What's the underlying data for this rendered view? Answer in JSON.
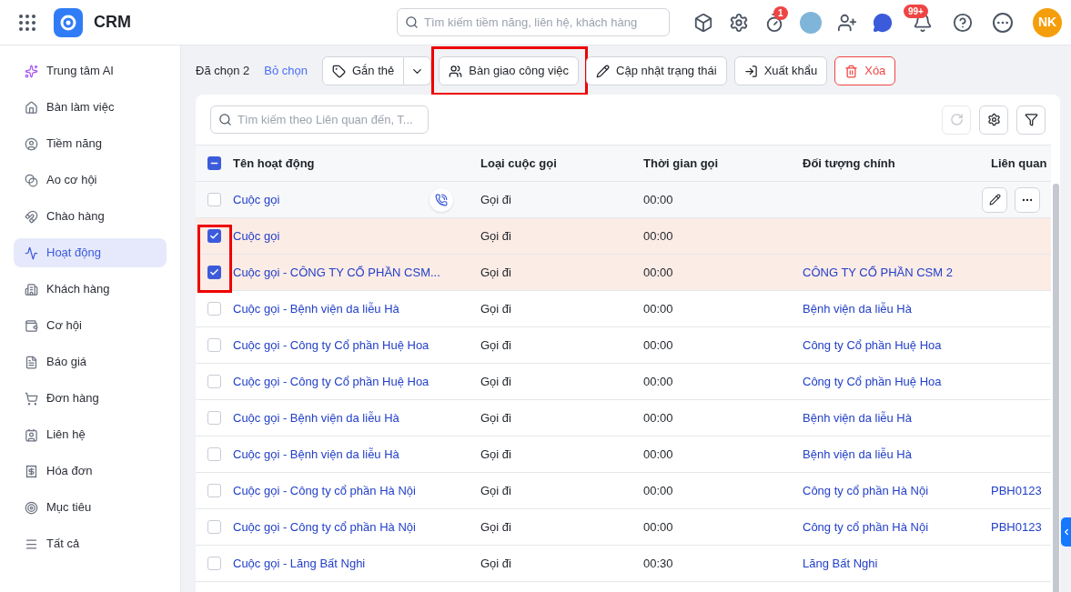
{
  "header": {
    "app_name": "CRM",
    "search": {
      "placeholder": "Tìm kiếm tiềm năng, liên hệ, khách hàng"
    },
    "timer_badge": "1",
    "notification_badge": "99+",
    "user_initials": "NK"
  },
  "sidebar": {
    "items": [
      {
        "label": "Trung tâm AI",
        "selected": false
      },
      {
        "label": "Bàn làm việc",
        "selected": false
      },
      {
        "label": "Tiềm năng",
        "selected": false
      },
      {
        "label": "Ao cơ hội",
        "selected": false
      },
      {
        "label": "Chào hàng",
        "selected": false
      },
      {
        "label": "Hoạt động",
        "selected": true
      },
      {
        "label": "Khách hàng",
        "selected": false
      },
      {
        "label": "Cơ hội",
        "selected": false
      },
      {
        "label": "Báo giá",
        "selected": false
      },
      {
        "label": "Đơn hàng",
        "selected": false
      },
      {
        "label": "Liên hệ",
        "selected": false
      },
      {
        "label": "Hóa đơn",
        "selected": false
      },
      {
        "label": "Mục tiêu",
        "selected": false
      },
      {
        "label": "Tất cả",
        "selected": false
      }
    ]
  },
  "bulk_bar": {
    "selected_count": "Đã chọn 2",
    "clear_link": "Bỏ chọn",
    "actions": [
      {
        "label": "Gắn thẻ",
        "kind": "split",
        "highlighted": false
      },
      {
        "label": "Bàn giao công việc",
        "kind": "normal",
        "highlighted": true
      },
      {
        "label": "Cập nhật trạng thái",
        "kind": "normal",
        "highlighted": false
      },
      {
        "label": "Xuất khẩu",
        "kind": "normal",
        "highlighted": false
      },
      {
        "label": "Xóa",
        "kind": "danger",
        "highlighted": false
      }
    ]
  },
  "table": {
    "search": {
      "placeholder": "Tìm kiếm theo Liên quan đến, T..."
    },
    "header_checkbox": {
      "indeterminate": true
    },
    "columns": [
      "Tên hoạt động",
      "Loại cuộc gọi",
      "Thời gian gọi",
      "Đối tượng chính",
      "Liên quan"
    ],
    "rows": [
      {
        "name": "Cuộc gọi",
        "type": "Gọi đi",
        "time": "00:00",
        "main_object": "",
        "related": "",
        "selected": false,
        "hovered": true
      },
      {
        "name": "Cuộc gọi",
        "type": "Gọi đi",
        "time": "00:00",
        "main_object": "",
        "related": "",
        "selected": true,
        "hovered": false
      },
      {
        "name": "Cuộc gọi - CÔNG TY CỔ PHẦN CSM...",
        "type": "Gọi đi",
        "time": "00:00",
        "main_object": "CÔNG TY CỔ PHẦN CSM 2",
        "related": "",
        "selected": true,
        "hovered": false
      },
      {
        "name": "Cuộc gọi - Bệnh viện da liễu Hà",
        "type": "Gọi đi",
        "time": "00:00",
        "main_object": "Bệnh viện da liễu Hà",
        "related": "",
        "selected": false,
        "hovered": false
      },
      {
        "name": "Cuộc gọi - Công ty Cổ phần Huệ Hoa",
        "type": "Gọi đi",
        "time": "00:00",
        "main_object": "Công ty Cổ phần Huệ Hoa",
        "related": "",
        "selected": false,
        "hovered": false
      },
      {
        "name": "Cuộc gọi - Công ty Cổ phần Huệ Hoa",
        "type": "Gọi đi",
        "time": "00:00",
        "main_object": "Công ty Cổ phần Huệ Hoa",
        "related": "",
        "selected": false,
        "hovered": false
      },
      {
        "name": "Cuộc gọi - Bệnh viện da liễu Hà",
        "type": "Gọi đi",
        "time": "00:00",
        "main_object": "Bệnh viện da liễu Hà",
        "related": "",
        "selected": false,
        "hovered": false
      },
      {
        "name": "Cuộc gọi - Bệnh viện da liễu Hà",
        "type": "Gọi đi",
        "time": "00:00",
        "main_object": "Bệnh viện da liễu Hà",
        "related": "",
        "selected": false,
        "hovered": false
      },
      {
        "name": "Cuộc gọi - Công ty cổ phần Hà Nội",
        "type": "Gọi đi",
        "time": "00:00",
        "main_object": "Công ty cổ phần Hà Nội",
        "related": "PBH0123",
        "selected": false,
        "hovered": false
      },
      {
        "name": "Cuộc gọi - Công ty cổ phần Hà Nội",
        "type": "Gọi đi",
        "time": "00:00",
        "main_object": "Công ty cổ phần Hà Nội",
        "related": "PBH0123",
        "selected": false,
        "hovered": false
      },
      {
        "name": "Cuộc gọi - Lăng Bất Nghi",
        "type": "Gọi đi",
        "time": "00:30",
        "main_object": "Lăng Bất Nghi",
        "related": "",
        "selected": false,
        "hovered": false
      }
    ]
  }
}
